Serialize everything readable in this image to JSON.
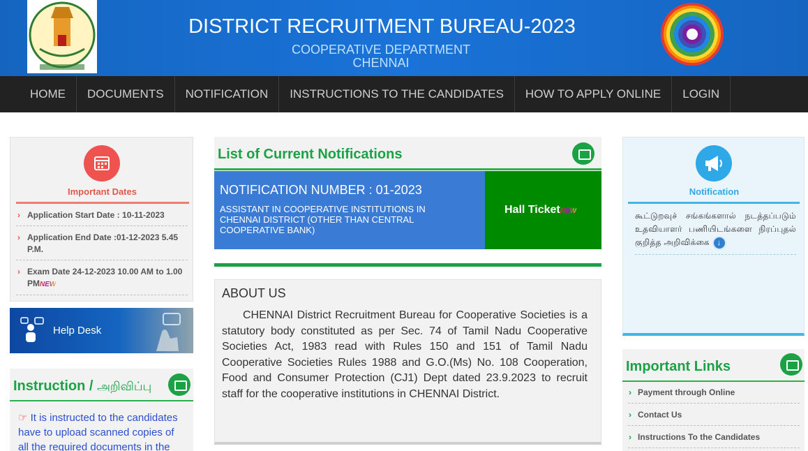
{
  "header": {
    "title": "DISTRICT RECRUITMENT BUREAU-2023",
    "subtitle_1": "COOPERATIVE DEPARTMENT",
    "subtitle_2": "CHENNAI"
  },
  "nav": {
    "items": [
      "HOME",
      "DOCUMENTS",
      "NOTIFICATION",
      "INSTRUCTIONS TO THE CANDIDATES",
      "HOW TO APPLY ONLINE",
      "LOGIN"
    ]
  },
  "important_dates": {
    "title": "Important Dates",
    "items": [
      {
        "text": "Application Start Date : 10-11-2023",
        "new": ""
      },
      {
        "text": "Application End Date :01-12-2023 5.45 P.M.",
        "new": ""
      },
      {
        "text": "Exam Date 24-12-2023 10.00 AM to 1.00 PM",
        "new": "NEW"
      }
    ]
  },
  "help_desk": {
    "label": "Help Desk"
  },
  "instruction": {
    "title_en": "Instruction /",
    "title_ta": "அறிவிப்பு",
    "text": "It is instructed to the candidates have to upload scanned copies of all the required documents in the"
  },
  "notifications": {
    "title": "List of Current Notifications",
    "number": "NOTIFICATION NUMBER : 01-2023",
    "description": "ASSISTANT IN COOPERATIVE INSTITUTIONS IN CHENNAI DISTRICT (OTHER THAN CENTRAL COOPERATIVE BANK)",
    "hall_ticket": "Hall Ticket",
    "hall_ticket_badge": "NEW"
  },
  "about": {
    "title": "ABOUT US",
    "text": "CHENNAI District Recruitment Bureau for Cooperative Societies is a statutory body constituted as per Sec. 74 of Tamil Nadu Cooperative Societies Act, 1983 read with Rules 150 and 151 of Tamil Nadu Cooperative Societies Rules 1988 and G.O.(Ms) No. 108 Cooperation, Food and Consumer Protection (CJ1) Dept dated 23.9.2023 to recruit staff for the cooperative institutions in CHENNAI District."
  },
  "right_notification": {
    "title": "Notification",
    "text": "கூட்டுறவுச் சங்கங்களால் நடத்தப்படும் உதவியாளர் பணியிடங்களை நிரப்புதல் குறித்த அறிவிக்கை"
  },
  "important_links": {
    "title": "Important Links",
    "items": [
      "Payment through Online",
      "Contact Us",
      "Instructions To the Candidates"
    ]
  },
  "colors": {
    "header_blue": "#1a73d8",
    "nav_dark": "#222222",
    "accent_green": "#1aa245",
    "accent_red": "#e2574c",
    "accent_sky": "#2fa8e8",
    "notif_blue": "#3a7bd5",
    "hall_green": "#008a00"
  }
}
